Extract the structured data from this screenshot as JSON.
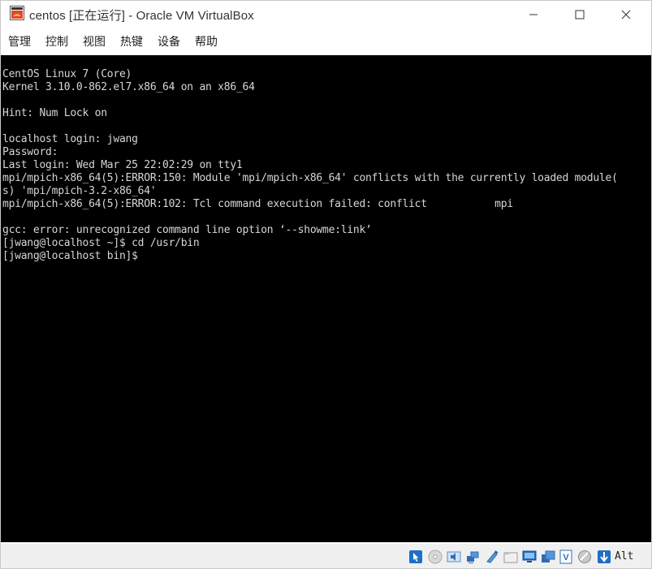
{
  "window": {
    "title": "centos [正在运行] - Oracle VM VirtualBox"
  },
  "menu": {
    "items": [
      "管理",
      "控制",
      "视图",
      "热键",
      "设备",
      "帮助"
    ]
  },
  "terminal": {
    "lines": [
      "CentOS Linux 7 (Core)",
      "Kernel 3.10.0-862.el7.x86_64 on an x86_64",
      "",
      "Hint: Num Lock on",
      "",
      "localhost login: jwang",
      "Password:",
      "Last login: Wed Mar 25 22:02:29 on tty1",
      "mpi/mpich-x86_64(5):ERROR:150: Module 'mpi/mpich-x86_64' conflicts with the currently loaded module(",
      "s) 'mpi/mpich-3.2-x86_64'",
      "mpi/mpich-x86_64(5):ERROR:102: Tcl command execution failed: conflict           mpi",
      "",
      "gcc: error: unrecognized command line option ‘--showme:link’",
      "[jwang@localhost ~]$ cd /usr/bin",
      "[jwang@localhost bin]$"
    ]
  },
  "statusbar": {
    "host_key_label": "Alt",
    "icons": [
      "mouse-integration-icon",
      "optical-drive-icon",
      "audio-icon",
      "network-icon",
      "usb-icon",
      "shared-folders-icon",
      "display-icon",
      "video-capture-icon",
      "virtualization-icon",
      "cpu-icon",
      "keyboard-capture-icon"
    ]
  },
  "colors": {
    "terminal_bg": "#000000",
    "terminal_fg": "#d6d6d6",
    "chrome_bg": "#ffffff",
    "statusbar_bg": "#f0f0f0"
  }
}
